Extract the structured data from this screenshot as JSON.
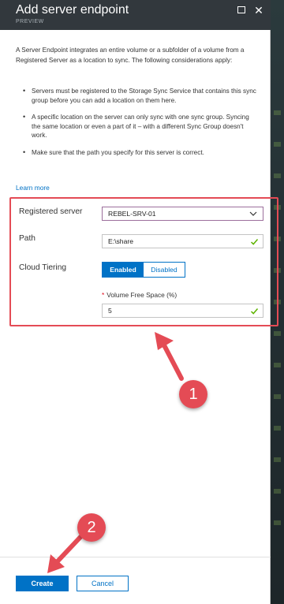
{
  "blade": {
    "title": "Add server endpoint",
    "subtitle": "PREVIEW"
  },
  "intro": "A Server Endpoint integrates an entire volume or a subfolder of a volume from a Registered Server as a location to sync. The following considerations apply:",
  "bullets": [
    "Servers must be registered to the Storage Sync Service that contains this sync group before you can add a location on them here.",
    "A specific location on the server can only sync with one sync group. Syncing the same location or even a part of it – with a different Sync Group doesn't work.",
    "Make sure that the path you specify for this server is correct."
  ],
  "learn_more": "Learn more",
  "form": {
    "registered_server_label": "Registered server",
    "registered_server_value": "REBEL-SRV-01",
    "path_label": "Path",
    "path_value": "E:\\share",
    "cloud_tiering_label": "Cloud Tiering",
    "cloud_tiering_options": [
      "Enabled",
      "Disabled"
    ],
    "cloud_tiering_selected": "Enabled",
    "volume_free_space_label": "Volume Free Space (%)",
    "volume_free_space_required_marker": "*",
    "volume_free_space_value": "5"
  },
  "annotations": {
    "callout_1": "1",
    "callout_2": "2",
    "highlight_color": "#e44b55"
  },
  "footer": {
    "create_label": "Create",
    "cancel_label": "Cancel"
  },
  "colors": {
    "accent": "#0072c6",
    "header_bg": "#32383d",
    "valid_check": "#5db300"
  }
}
